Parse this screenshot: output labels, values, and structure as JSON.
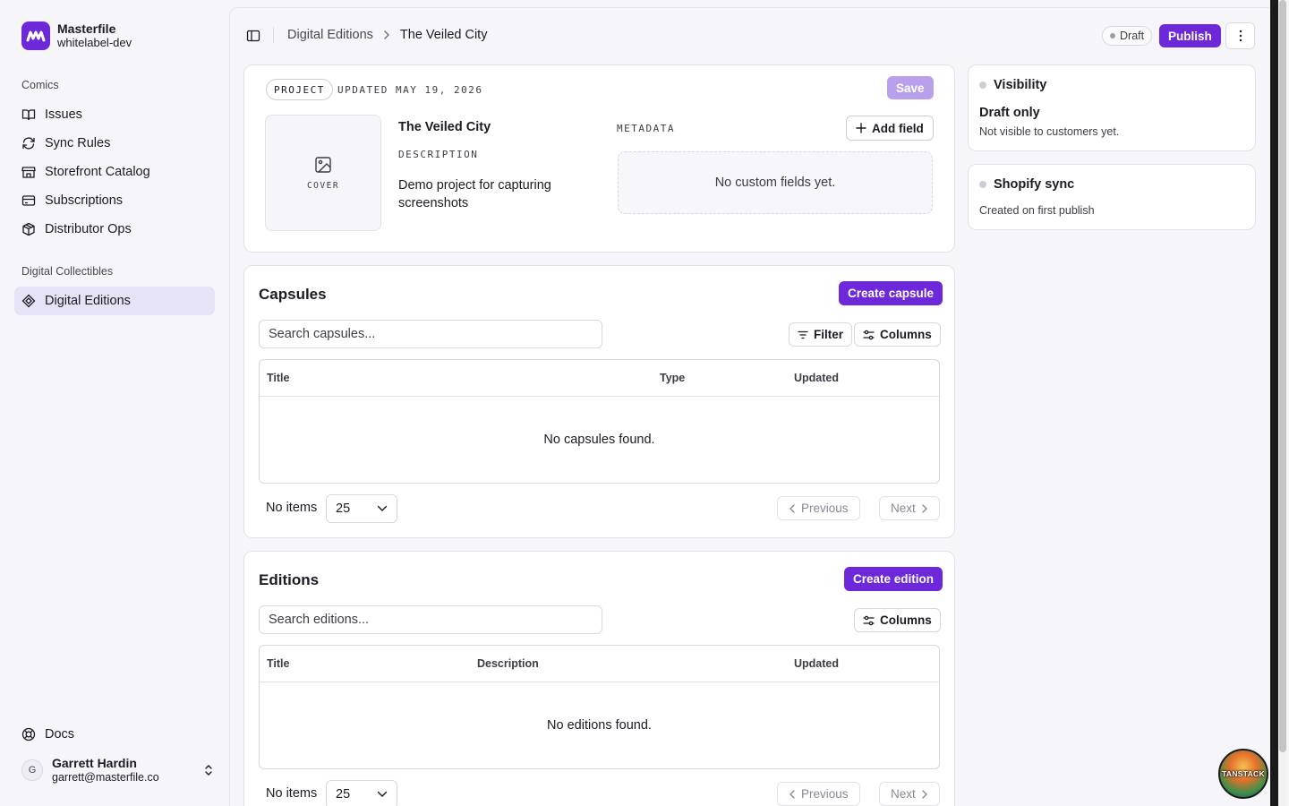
{
  "brand": {
    "name": "Masterfile",
    "workspace": "whitelabel-dev"
  },
  "sidebar": {
    "sections": [
      {
        "label": "Comics",
        "items": [
          {
            "label": "Issues",
            "icon": "book-open-icon"
          },
          {
            "label": "Sync Rules",
            "icon": "refresh-icon"
          },
          {
            "label": "Storefront Catalog",
            "icon": "store-icon"
          },
          {
            "label": "Subscriptions",
            "icon": "credit-card-icon"
          },
          {
            "label": "Distributor Ops",
            "icon": "package-icon"
          }
        ]
      },
      {
        "label": "Digital Collectibles",
        "items": [
          {
            "label": "Digital Editions",
            "icon": "diamond-icon",
            "active": true
          }
        ]
      }
    ],
    "docs_label": "Docs",
    "user": {
      "initial": "G",
      "name": "Garrett Hardin",
      "email": "garrett@masterfile.co"
    }
  },
  "header": {
    "breadcrumb": [
      "Digital Editions",
      "The Veiled City"
    ],
    "status_badge": "Draft",
    "publish_label": "Publish"
  },
  "project": {
    "type_pill": "PROJECT",
    "updated": "UPDATED MAY 19, 2026",
    "save_label": "Save",
    "cover_label": "COVER",
    "title": "The Veiled City",
    "description_label": "DESCRIPTION",
    "description": "Demo project for capturing screenshots",
    "metadata_label": "METADATA",
    "add_field_label": "Add field",
    "metadata_empty": "No custom fields yet."
  },
  "capsules": {
    "title": "Capsules",
    "create_label": "Create capsule",
    "search_placeholder": "Search capsules...",
    "filter_label": "Filter",
    "columns_label": "Columns",
    "columns": [
      "Title",
      "Type",
      "Updated"
    ],
    "empty": "No capsules found.",
    "items_label": "No items",
    "page_size": "25",
    "prev_label": "Previous",
    "next_label": "Next"
  },
  "editions": {
    "title": "Editions",
    "create_label": "Create edition",
    "search_placeholder": "Search editions...",
    "columns_label": "Columns",
    "columns": [
      "Title",
      "Description",
      "Updated"
    ],
    "empty": "No editions found.",
    "items_label": "No items",
    "page_size": "25",
    "prev_label": "Previous",
    "next_label": "Next"
  },
  "visibility": {
    "title": "Visibility",
    "value": "Draft only",
    "note": "Not visible to customers yet."
  },
  "shopify": {
    "title": "Shopify sync",
    "note": "Created on first publish"
  },
  "devtools_label": "TANSTACK",
  "colors": {
    "accent": "#6d28d9",
    "accent_disabled": "#b9a0ec",
    "active_nav": "#e7e3f6"
  }
}
